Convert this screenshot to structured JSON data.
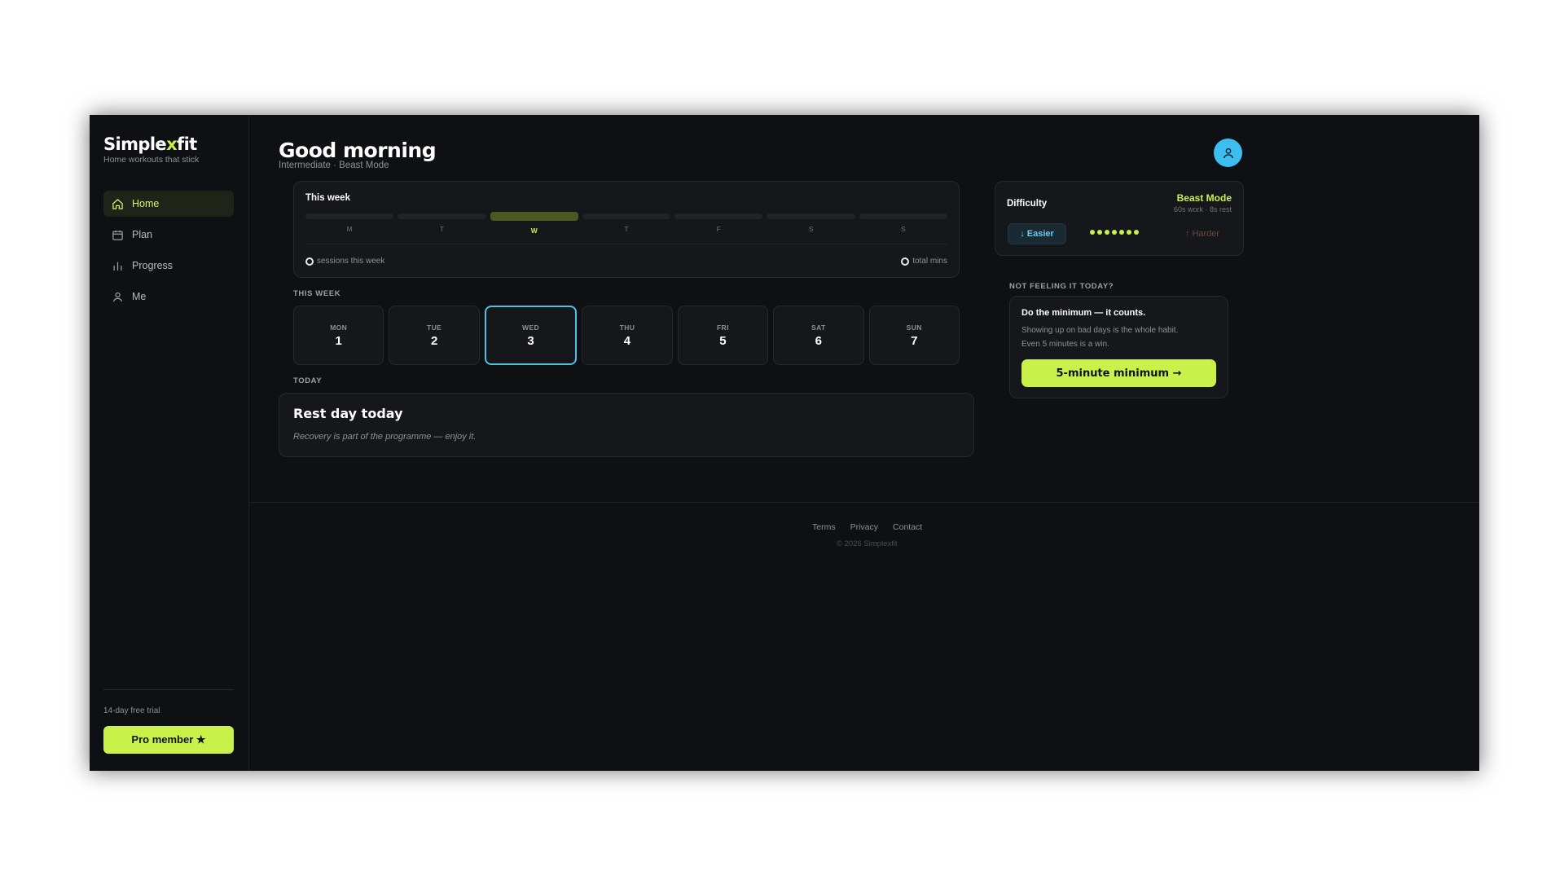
{
  "brand": {
    "name_main": "Simple",
    "name_accent": "x",
    "name_end": "fit",
    "tagline": "Home workouts that stick"
  },
  "sidebar": {
    "items": [
      {
        "label": "Home",
        "icon": "home-icon",
        "active": true
      },
      {
        "label": "Plan",
        "icon": "calendar-icon",
        "active": false
      },
      {
        "label": "Progress",
        "icon": "bar-chart-icon",
        "active": false
      },
      {
        "label": "Me",
        "icon": "user-icon",
        "active": false
      }
    ],
    "trial_text": "14-day free trial",
    "pro_button": "Pro member ★"
  },
  "header": {
    "greeting": "Good morning",
    "subtitle": "Intermediate · Beast Mode",
    "avatar_icon": "user-icon"
  },
  "week_summary": {
    "title": "This week",
    "bars": [
      {
        "label": "M",
        "active": false
      },
      {
        "label": "T",
        "active": false
      },
      {
        "label": "W",
        "active": true
      },
      {
        "label": "T",
        "active": false
      },
      {
        "label": "F",
        "active": false
      },
      {
        "label": "S",
        "active": false
      },
      {
        "label": "S",
        "active": false
      }
    ],
    "sessions_value": "0",
    "sessions_label": "sessions this week",
    "mins_value": "0",
    "mins_label": "total mins"
  },
  "this_week": {
    "label": "THIS WEEK",
    "days": [
      {
        "name": "MON",
        "num": "1",
        "active": false
      },
      {
        "name": "TUE",
        "num": "2",
        "active": false
      },
      {
        "name": "WED",
        "num": "3",
        "active": true
      },
      {
        "name": "THU",
        "num": "4",
        "active": false
      },
      {
        "name": "FRI",
        "num": "5",
        "active": false
      },
      {
        "name": "SAT",
        "num": "6",
        "active": false
      },
      {
        "name": "SUN",
        "num": "7",
        "active": false
      }
    ]
  },
  "today": {
    "label": "TODAY",
    "title": "Rest day today",
    "subtitle": "Recovery is part of the programme — enjoy it."
  },
  "difficulty": {
    "title": "Difficulty",
    "mode": "Beast Mode",
    "detail": "60s work · 8s rest",
    "easier": "↓ Easier",
    "harder": "↑ Harder",
    "level": 7
  },
  "minimum": {
    "label": "NOT FEELING IT TODAY?",
    "title": "Do the minimum — it counts.",
    "body_line1": "Showing up on bad days is the whole habit.",
    "body_line2": "Even 5 minutes is a win.",
    "button": "5-minute minimum →"
  },
  "footer": {
    "links": [
      "Terms",
      "Privacy",
      "Contact"
    ],
    "copyright": "© 2026 Simplexfit"
  },
  "colors": {
    "accent": "#c8f24a",
    "avatar": "#3dbef0",
    "background": "#0f1013",
    "highlight_border": "#4cc3e6"
  }
}
